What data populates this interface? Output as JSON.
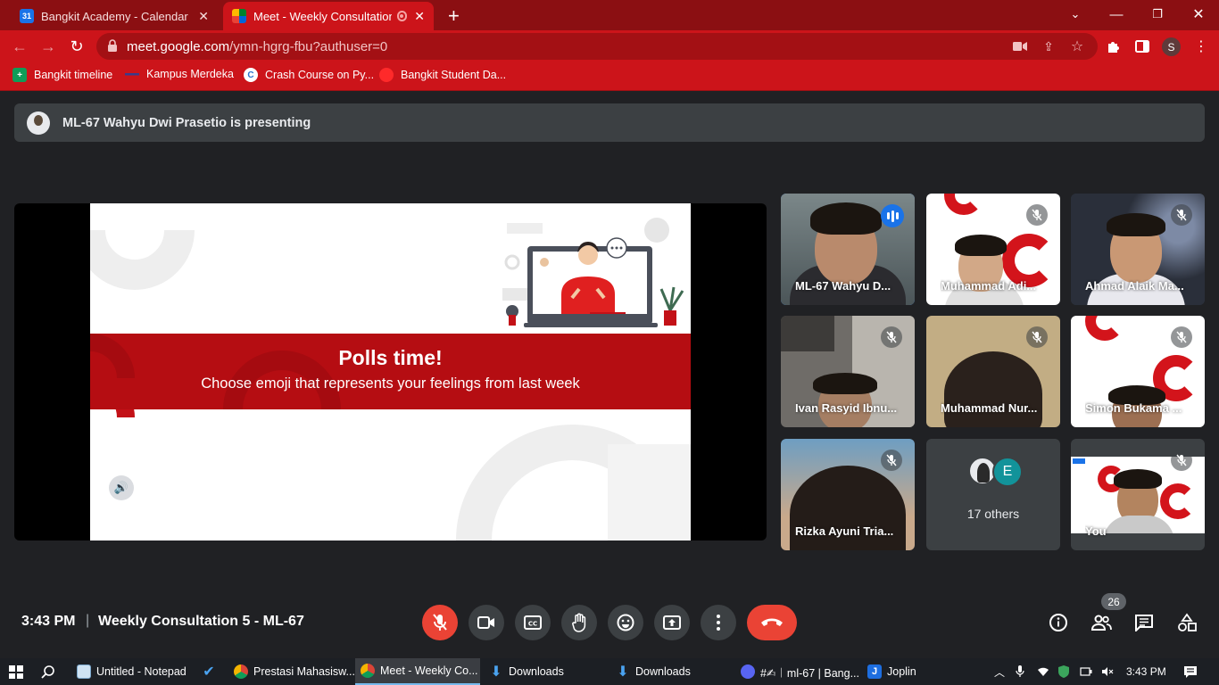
{
  "browser": {
    "tabs": [
      {
        "title": "Bangkit Academy - Calendar - Ev",
        "icon": "google-calendar-icon",
        "active": false
      },
      {
        "title": "Meet - Weekly Consultation",
        "icon": "google-meet-icon",
        "active": true
      }
    ],
    "new_tab": "+",
    "url_host": "meet.google.com",
    "url_path": "/ymn-hgrg-fbu?authuser=0",
    "profile_initial": "S",
    "bookmarks": [
      {
        "label": "Bangkit timeline",
        "icon": "google-sheets-icon"
      },
      {
        "label": "Kampus Merdeka",
        "icon": "kampus-merdeka-icon"
      },
      {
        "label": "Crash Course on Py...",
        "icon": "coursera-icon"
      },
      {
        "label": "Bangkit Student Da...",
        "icon": "bangkit-icon"
      }
    ]
  },
  "meet": {
    "presenting_text": "ML-67 Wahyu Dwi Prasetio is presenting",
    "slide": {
      "title": "Polls time!",
      "subtitle": "Choose emoji that represents your feelings from last week"
    },
    "participants": [
      {
        "name": "ML-67 Wahyu D...",
        "speaking": true,
        "muted": false
      },
      {
        "name": "Muhammad Adi...",
        "speaking": false,
        "muted": true
      },
      {
        "name": "Ahmad Alaik Ma...",
        "speaking": false,
        "muted": true
      },
      {
        "name": "Ivan Rasyid Ibnu...",
        "speaking": false,
        "muted": true
      },
      {
        "name": "Muhammad Nur...",
        "speaking": false,
        "muted": true
      },
      {
        "name": "Simon Bukama ...",
        "speaking": false,
        "muted": true
      },
      {
        "name": "Rizka Ayuni Tria...",
        "speaking": false,
        "muted": true
      },
      {
        "name": "You",
        "speaking": false,
        "muted": true
      }
    ],
    "others": {
      "avatar_letter": "E",
      "label": "17 others"
    },
    "time": "3:43 PM",
    "divider": "|",
    "meeting_name": "Weekly Consultation 5 - ML-67",
    "participant_count": "26"
  },
  "taskbar": {
    "items": [
      {
        "label": "Untitled - Notepad"
      },
      {
        "label": "Prestasi Mahasisw..."
      },
      {
        "label": "Meet - Weekly Co..."
      },
      {
        "label": "Downloads"
      },
      {
        "label": "Downloads"
      },
      {
        "label": "#✍︱ml-67 | Bang..."
      },
      {
        "label": "Joplin"
      }
    ],
    "time": "3:43 PM"
  },
  "colors": {
    "browser_frame": "#8b0f12",
    "browser_toolbar": "#cc141a",
    "meet_bg": "#202124",
    "tile_bg": "#3c4043",
    "danger": "#ea4335",
    "speaking": "#1a73e8",
    "slide_banner": "#b50d12"
  }
}
